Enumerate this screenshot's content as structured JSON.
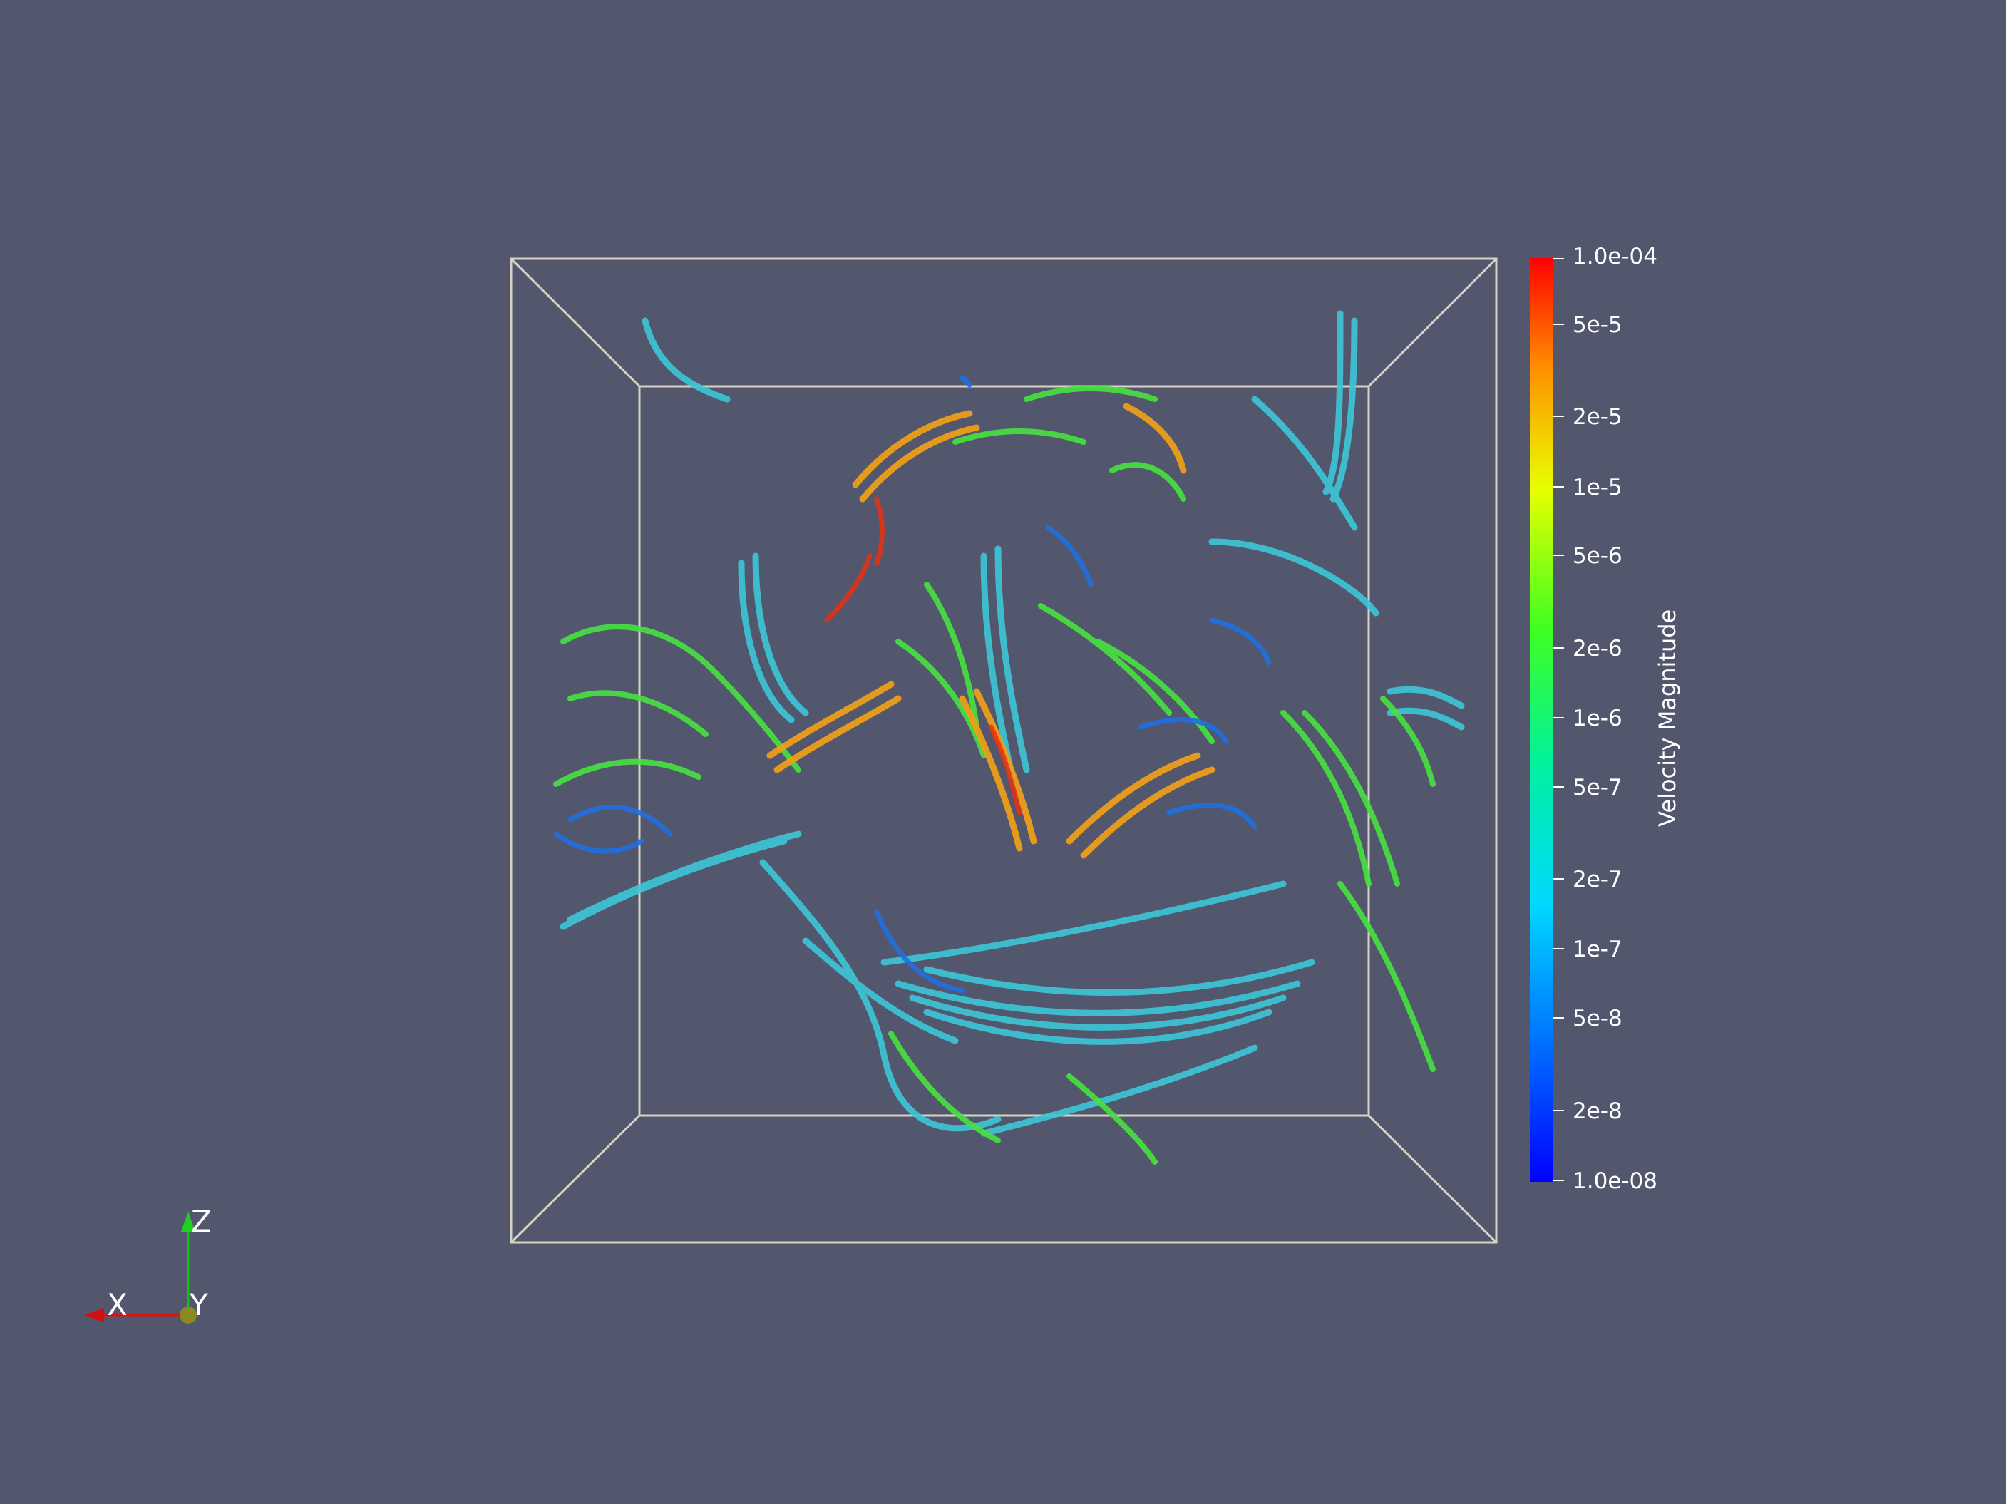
{
  "scene": {
    "background": "#52576e",
    "outline_color": "#d8d2c4"
  },
  "colorbar": {
    "title": "Velocity Magnitude",
    "scale": "log",
    "range": [
      1e-08,
      0.0001
    ],
    "min_label": "1.0e-08",
    "max_label": "1.0e-04",
    "labels": [
      "1.0e-04",
      "5e-5",
      "2e-5",
      "1e-5",
      "5e-6",
      "2e-6",
      "1e-6",
      "5e-7",
      "2e-7",
      "1e-7",
      "5e-8",
      "2e-8",
      "1.0e-08"
    ],
    "colormap": [
      "#0000ff",
      "#0080ff",
      "#00e0ff",
      "#00ff80",
      "#60ff00",
      "#ffff00",
      "#ff8000",
      "#ff0000"
    ]
  },
  "axes": {
    "x_label": "X",
    "y_label": "Y",
    "z_label": "Z",
    "x_color": "#e01010",
    "z_color": "#10c010",
    "y_color": "#8a8a20"
  }
}
